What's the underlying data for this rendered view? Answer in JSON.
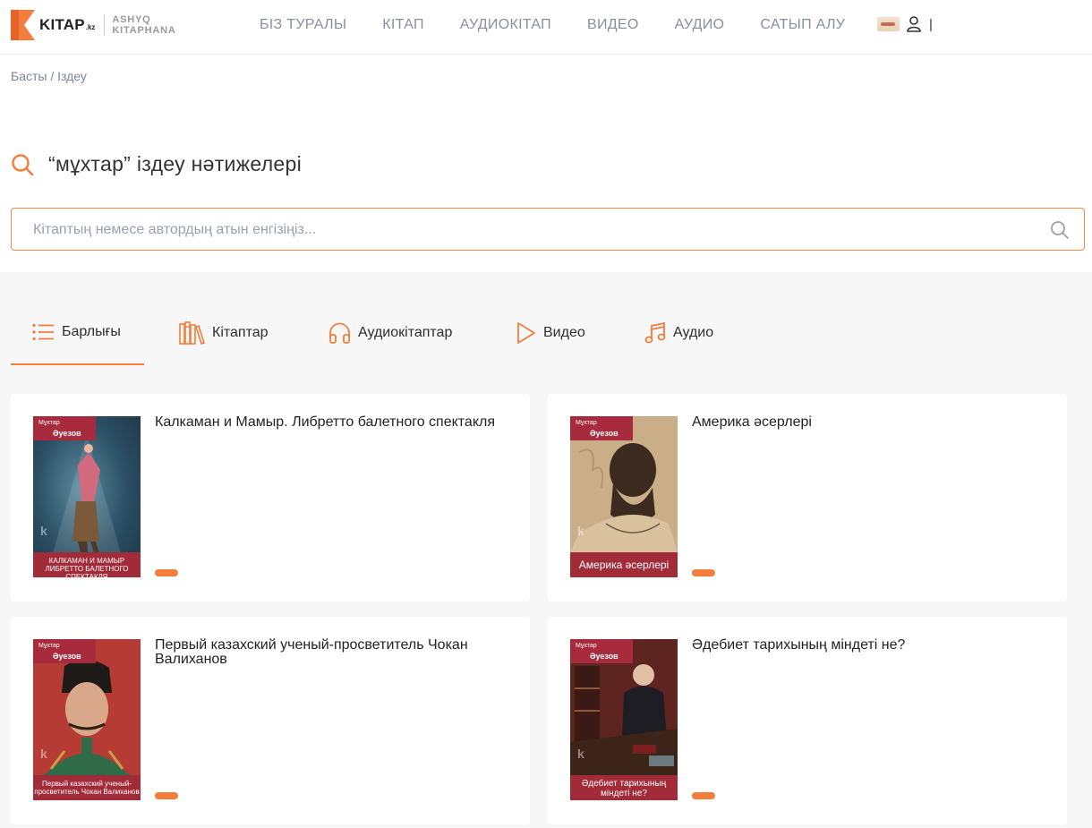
{
  "header": {
    "logo_word": "KITAP",
    "logo_kz": ".kz",
    "logo_sub_1": "ASHYQ",
    "logo_sub_2": "KITAPHANA",
    "nav": [
      "БІЗ ТУРАЛЫ",
      "КІТАП",
      "АУДИОКІТАП",
      "ВИДЕО",
      "АУДИО",
      "САТЫП АЛУ"
    ],
    "user_sep": "|"
  },
  "breadcrumb": {
    "home": "Басты",
    "separator": " / ",
    "current": "Іздеу"
  },
  "search": {
    "title": "“мұхтар” іздеу нәтижелері",
    "placeholder": "Кітаптың немесе автордың атын енгізіңіз..."
  },
  "tabs": [
    {
      "label": "Барлығы",
      "icon": "list-icon",
      "active": true
    },
    {
      "label": "Кітаптар",
      "icon": "books-icon",
      "active": false
    },
    {
      "label": "Аудиокітаптар",
      "icon": "headphones-icon",
      "active": false
    },
    {
      "label": "Видео",
      "icon": "play-icon",
      "active": false
    },
    {
      "label": "Аудио",
      "icon": "music-icon",
      "active": false
    }
  ],
  "results": [
    {
      "title": "Калкаман и Мамыр. Либретто балетного спектакля",
      "cover_author_1": "Мұхтар",
      "cover_author_2": "Әуезов",
      "cover_title": "КАЛКАМАН И МАМЫР ЛИБРЕТТО БАЛЕТНОГО СПЕКТАКЛЯ"
    },
    {
      "title": "Америка әсерлері",
      "cover_author_1": "Мұхтар",
      "cover_author_2": "Әуезов",
      "cover_title": "Америка әсерлері"
    },
    {
      "title": "Первый казахский ученый-просветитель Чокан Валиханов",
      "cover_author_1": "Мұхтар",
      "cover_author_2": "Әуезов",
      "cover_title": "Первый казахский ученый-просветитель Чокан Валиханов"
    },
    {
      "title": "Әдебиет тарихының міндеті не?",
      "cover_author_1": "Мұхтар",
      "cover_author_2": "Әуезов",
      "cover_title": "Әдебиет тарихының міндеті не?"
    }
  ],
  "colors": {
    "accent": "#f47d3c",
    "cover_red": "#a72a3d"
  }
}
